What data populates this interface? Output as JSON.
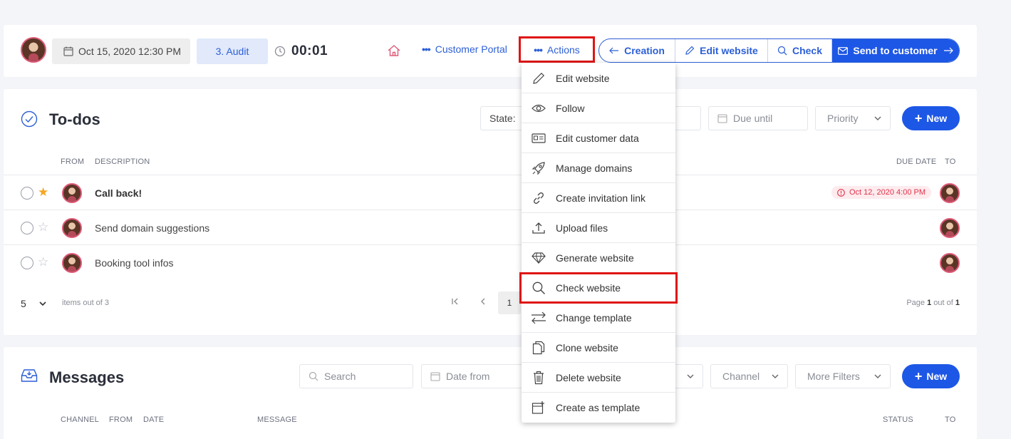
{
  "topbar": {
    "date": "Oct 15, 2020 12:30 PM",
    "stage": "3. Audit",
    "timer": "00:01",
    "customer_portal": "Customer Portal",
    "actions": "Actions",
    "buttons": {
      "creation": "Creation",
      "edit_website": "Edit website",
      "check": "Check",
      "send": "Send to customer"
    }
  },
  "todos": {
    "title": "To-dos",
    "filters": {
      "state": "State:",
      "due_until": "Due until",
      "priority": "Priority"
    },
    "new_label": "New",
    "columns": {
      "from": "FROM",
      "description": "DESCRIPTION",
      "due_date": "DUE DATE",
      "to": "TO"
    },
    "rows": [
      {
        "description": "Call back!",
        "due": "Oct 12, 2020 4:00 PM",
        "starred": true
      },
      {
        "description": "Send domain suggestions",
        "due": "",
        "starred": false
      },
      {
        "description": "Booking tool infos",
        "due": "",
        "starred": false
      }
    ],
    "pager": {
      "page_size": "5",
      "items_text": "items out of 3",
      "current_page": "1",
      "page_label": "Page",
      "page_num": "1",
      "out_of": "out of",
      "page_total": "1"
    }
  },
  "messages": {
    "title": "Messages",
    "filters": {
      "search": "Search",
      "date_from": "Date from",
      "channel": "Channel",
      "more_filters": "More Filters"
    },
    "new_label": "New",
    "columns": {
      "channel": "CHANNEL",
      "from": "FROM",
      "date": "DATE",
      "message": "MESSAGE",
      "status": "STATUS",
      "to": "TO"
    }
  },
  "actions_menu": {
    "items": [
      {
        "label": "Edit website",
        "icon": "pencil-icon"
      },
      {
        "label": "Follow",
        "icon": "eye-icon"
      },
      {
        "label": "Edit customer data",
        "icon": "id-card-icon"
      },
      {
        "label": "Manage domains",
        "icon": "rocket-icon"
      },
      {
        "label": "Create invitation link",
        "icon": "link-icon"
      },
      {
        "label": "Upload files",
        "icon": "upload-icon"
      },
      {
        "label": "Generate website",
        "icon": "diamond-icon"
      },
      {
        "label": "Check website",
        "icon": "search-icon"
      },
      {
        "label": "Change template",
        "icon": "swap-arrows-icon"
      },
      {
        "label": "Clone website",
        "icon": "copy-icon"
      },
      {
        "label": "Delete website",
        "icon": "trash-icon"
      },
      {
        "label": "Create as template",
        "icon": "template-icon"
      }
    ],
    "highlighted": "Check website"
  },
  "colors": {
    "primary": "#1d57e6",
    "link": "#2c5fd6",
    "highlight_box": "#e01414",
    "due_badge_text": "#e0334a",
    "star": "#f5a623"
  }
}
